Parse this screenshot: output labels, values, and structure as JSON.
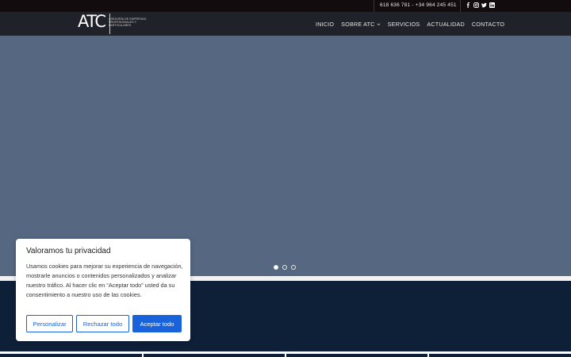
{
  "topbar": {
    "phones": "618 636 781 - +34 964 245 451",
    "social_icons": [
      "facebook-icon",
      "instagram-icon",
      "twitter-icon",
      "linkedin-icon"
    ]
  },
  "logo": {
    "mark": "ATC",
    "tagline": "Asesoría de empresas, profesionales y particulares"
  },
  "nav": {
    "items": [
      "INICIO",
      "SOBRE ATC",
      "SERVICIOS",
      "ACTUALIDAD",
      "CONTACTO"
    ]
  },
  "slider": {
    "slides": 3,
    "active": 1
  },
  "cookie": {
    "title": "Valoramos tu privacidad",
    "body": "Usamos cookies para mejorar su experiencia de navegación, mostrarle anuncios o contenidos personalizados y analizar nuestro tráfico. Al hacer clic en “Aceptar todo” usted da su consentimiento a nuestro uso de las cookies.",
    "customize_label": "Personalizar",
    "reject_label": "Rechazar todo",
    "accept_label": "Aceptar todo"
  },
  "colors": {
    "topbar": "#120c0f",
    "navbar": "#1f2229",
    "hero": "#566782",
    "band": "#0e1f38",
    "accent": "#1863dc"
  }
}
